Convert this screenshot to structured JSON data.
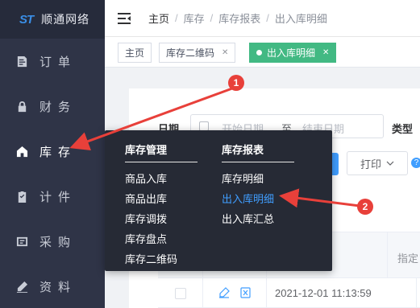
{
  "app": {
    "logo_mark": "ST",
    "name": "顺通网络"
  },
  "sidebar": {
    "items": [
      {
        "label": "订单",
        "icon": "order-icon"
      },
      {
        "label": "财务",
        "icon": "lock-icon"
      },
      {
        "label": "库存",
        "icon": "home-icon"
      },
      {
        "label": "计件",
        "icon": "clipboard-icon"
      },
      {
        "label": "采购",
        "icon": "purchase-icon"
      },
      {
        "label": "资料",
        "icon": "pen-icon"
      }
    ]
  },
  "breadcrumb": [
    "主页",
    "库存",
    "库存报表",
    "出入库明细"
  ],
  "tabs": [
    {
      "label": "主页",
      "closable": false,
      "active": false
    },
    {
      "label": "库存二维码",
      "closable": true,
      "active": false
    },
    {
      "label": "出入库明细",
      "closable": true,
      "active": true
    }
  ],
  "filter": {
    "date_label": "日期",
    "start_placeholder": "开始日期",
    "to_label": "至",
    "end_placeholder": "结束日期",
    "type_label": "类型"
  },
  "toolbar": {
    "print_label": "打印"
  },
  "table": {
    "header_partial": "指定",
    "rows": [
      {
        "time": "2021-12-01 11:13:59"
      }
    ]
  },
  "dropdown": {
    "groups": [
      {
        "title": "库存管理",
        "items": [
          "商品入库",
          "商品出库",
          "库存调拨",
          "库存盘点",
          "库存二维码"
        ]
      },
      {
        "title": "库存报表",
        "items": [
          "库存明细",
          "出入库明细",
          "出入库汇总"
        ],
        "selected": "出入库明细"
      }
    ]
  },
  "annotations": {
    "badge1": "1",
    "badge2": "2"
  },
  "colors": {
    "sidebar": "#2f3447",
    "accent": "#409eff",
    "active_tab": "#42b983",
    "annotation": "#e8403a"
  }
}
